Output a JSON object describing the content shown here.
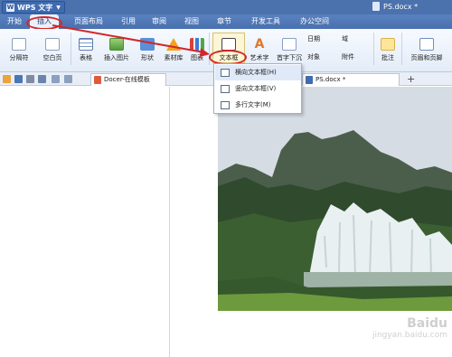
{
  "titlebar": {
    "app_name": "WPS 文字",
    "doc_title": "PS.docx *"
  },
  "menu": {
    "tabs": [
      "开始",
      "插入",
      "页面布局",
      "引用",
      "审阅",
      "视图",
      "章节",
      "开发工具",
      "办公空间"
    ],
    "active_index": 1
  },
  "ribbon": {
    "page_break": "分隔符",
    "blank_page": "空白页",
    "table": "表格",
    "insert_picture": "插入图片",
    "shapes": "形状",
    "material": "素材库",
    "chart": "图表",
    "textbox": "文本框",
    "wordart": "艺术字",
    "first_drop": "首字下沉",
    "date": "日期",
    "field": "域",
    "object": "对象",
    "attachment": "附件",
    "comment": "批注",
    "header_footer": "页眉和页脚"
  },
  "tabs": {
    "docer": "Docer-在线模板",
    "ps_doc": "PS.docx *"
  },
  "dropdown": {
    "items": [
      "横向文本框(H)",
      "竖向文本框(V)",
      "多行文字(M)"
    ],
    "highlighted_index": 0
  },
  "watermark": {
    "brand": "Baidu",
    "sub": "jingyan.baidu.com"
  },
  "colors": {
    "accent": "#4c72ad",
    "highlight_ring": "#d3262a"
  },
  "icons": [
    "app-logo-icon",
    "document-icon",
    "table-icon",
    "picture-icon",
    "shape-icon",
    "star-icon",
    "chart-icon",
    "textbox-icon",
    "wordart-icon",
    "comment-icon",
    "header-footer-icon",
    "new-tab-plus-icon"
  ]
}
